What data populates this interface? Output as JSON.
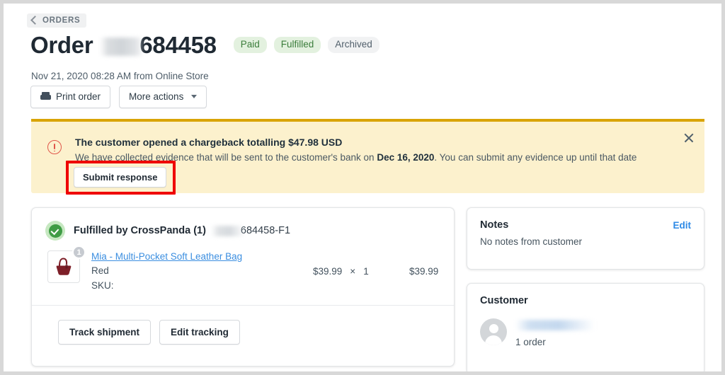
{
  "back": {
    "label": "ORDERS",
    "icon": "chevron-left-icon"
  },
  "header": {
    "title": "Order",
    "order_number": "684458",
    "badges": [
      {
        "label": "Paid",
        "tone": "green"
      },
      {
        "label": "Fulfilled",
        "tone": "green"
      },
      {
        "label": "Archived",
        "tone": "grey"
      }
    ],
    "meta": "Nov 21, 2020 08:28 AM from Online Store",
    "actions": [
      {
        "label": "Print order",
        "icon": "printer-icon"
      },
      {
        "label": "More actions",
        "icon": "chevron-down-icon"
      }
    ]
  },
  "banner": {
    "title": "The customer opened a chargeback totalling $47.98 USD",
    "body_before": "We have collected evidence that will be sent to the customer's bank on ",
    "body_bold": "Dec 16, 2020",
    "body_after": ". You can submit any evidence up until that date",
    "button": "Submit response",
    "close_icon": "close-icon",
    "warn_icon": "alert-circle-icon",
    "accent_color": "#d9a406",
    "background_color": "#fcf1cd",
    "annotation_color": "#ef0000"
  },
  "fulfillment": {
    "title": "Fulfilled by CrossPanda (1)",
    "reference": "684458-F1",
    "status_icon": "check-circle-icon",
    "item": {
      "name": "Mia - Multi-Pocket Soft Leather Bag",
      "variant": "Red",
      "sku_label": "SKU:",
      "quantity_badge": "1",
      "unit_price": "$39.99",
      "multiplier": "×",
      "quantity": "1",
      "line_total": "$39.99",
      "image": "handbag-thumbnail"
    },
    "buttons": [
      {
        "label": "Track shipment"
      },
      {
        "label": "Edit tracking"
      }
    ]
  },
  "notes": {
    "title": "Notes",
    "edit_label": "Edit",
    "body": "No notes from customer"
  },
  "customer": {
    "title": "Customer",
    "avatar": "avatar-placeholder-icon",
    "orders": "1 order"
  }
}
